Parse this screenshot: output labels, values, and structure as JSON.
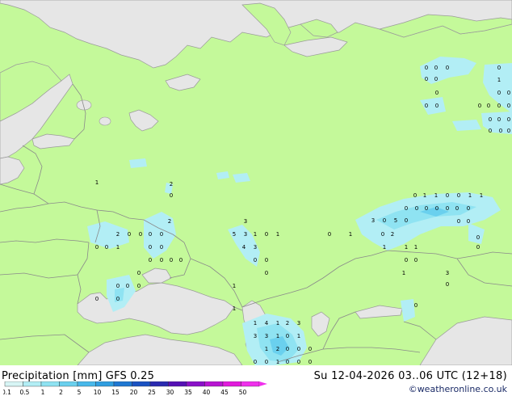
{
  "header": {
    "title": "Precipitation [mm]  GFS 0.25",
    "datetime": "Su 12-04-2026 03..06 UTC (12+18)"
  },
  "footer": {
    "credit": "©weatheronline.co.uk"
  },
  "legend": {
    "colors": [
      "#d7f5f5",
      "#b2eef5",
      "#8fe3f2",
      "#6ad0ee",
      "#48b8ea",
      "#2f9ee0",
      "#1e78d2",
      "#1a52c2",
      "#2a2ab0",
      "#5510b4",
      "#8a10c8",
      "#b814d2",
      "#e21adc",
      "#f030ec"
    ],
    "labels": [
      {
        "t": "0.1",
        "i": 0
      },
      {
        "t": "0.5",
        "i": 1
      },
      {
        "t": "1",
        "i": 2
      },
      {
        "t": "2",
        "i": 3
      },
      {
        "t": "5",
        "i": 4
      },
      {
        "t": "10",
        "i": 5
      },
      {
        "t": "15",
        "i": 6
      },
      {
        "t": "20",
        "i": 7
      },
      {
        "t": "25",
        "i": 8
      },
      {
        "t": "30",
        "i": 9
      },
      {
        "t": "35",
        "i": 10
      },
      {
        "t": "40",
        "i": 11
      },
      {
        "t": "45",
        "i": 12
      },
      {
        "t": "50",
        "i": 13
      }
    ]
  },
  "map": {
    "colors": {
      "land": "#c4f99a",
      "sea": "#e6e6e6",
      "border": "#8a8a8a",
      "coast": "#9a9a9a"
    },
    "precip_labels": [
      {
        "t": "0"
      },
      {
        "t": "0"
      },
      {
        "t": "0"
      },
      {
        "t": "0"
      },
      {
        "t": "0"
      },
      {
        "t": "0"
      },
      {
        "t": "0"
      },
      {
        "t": "0"
      },
      {
        "t": "0"
      },
      {
        "t": "1"
      },
      {
        "t": "0"
      },
      {
        "t": "0"
      },
      {
        "t": "0"
      },
      {
        "t": "0"
      },
      {
        "t": "0"
      },
      {
        "t": "0"
      },
      {
        "t": "0"
      },
      {
        "t": "0"
      },
      {
        "t": "0"
      },
      {
        "t": "0"
      },
      {
        "t": "0"
      },
      {
        "t": "0"
      },
      {
        "t": "0"
      },
      {
        "t": "1"
      },
      {
        "t": "1"
      },
      {
        "t": "0"
      },
      {
        "t": "0"
      },
      {
        "t": "1"
      },
      {
        "t": "1"
      },
      {
        "t": "0"
      },
      {
        "t": "0"
      },
      {
        "t": "0"
      },
      {
        "t": "0"
      },
      {
        "t": "0"
      },
      {
        "t": "0"
      },
      {
        "t": "0"
      },
      {
        "t": "3"
      },
      {
        "t": "0"
      },
      {
        "t": "5"
      },
      {
        "t": "0"
      },
      {
        "t": "0"
      },
      {
        "t": "2"
      },
      {
        "t": "0"
      },
      {
        "t": "0"
      },
      {
        "t": "0"
      },
      {
        "t": "0"
      },
      {
        "t": "1"
      },
      {
        "t": "1"
      },
      {
        "t": "1"
      },
      {
        "t": "0"
      },
      {
        "t": "0"
      },
      {
        "t": "1"
      },
      {
        "t": "3"
      },
      {
        "t": "0"
      },
      {
        "t": "0"
      },
      {
        "t": "1"
      },
      {
        "t": "1"
      },
      {
        "t": "1"
      },
      {
        "t": "4"
      },
      {
        "t": "1"
      },
      {
        "t": "2"
      },
      {
        "t": "3"
      },
      {
        "t": "3"
      },
      {
        "t": "3"
      },
      {
        "t": "1"
      },
      {
        "t": "0"
      },
      {
        "t": "1"
      },
      {
        "t": "1"
      },
      {
        "t": "2"
      },
      {
        "t": "0"
      },
      {
        "t": "0"
      },
      {
        "t": "0"
      },
      {
        "t": "0"
      },
      {
        "t": "2"
      },
      {
        "t": "0"
      },
      {
        "t": "1"
      },
      {
        "t": "3"
      },
      {
        "t": "5"
      },
      {
        "t": "3"
      },
      {
        "t": "1"
      },
      {
        "t": "0"
      },
      {
        "t": "1"
      },
      {
        "t": "4"
      },
      {
        "t": "3"
      },
      {
        "t": "0"
      },
      {
        "t": "0"
      },
      {
        "t": "0"
      },
      {
        "t": "0"
      },
      {
        "t": "1"
      },
      {
        "t": "2"
      },
      {
        "t": "0"
      },
      {
        "t": "0"
      },
      {
        "t": "0"
      },
      {
        "t": "0"
      },
      {
        "t": "2"
      },
      {
        "t": "0"
      },
      {
        "t": "0"
      },
      {
        "t": "0"
      },
      {
        "t": "0"
      },
      {
        "t": "0"
      },
      {
        "t": "0"
      },
      {
        "t": "0"
      },
      {
        "t": "0"
      },
      {
        "t": "1"
      },
      {
        "t": "0"
      },
      {
        "t": "0"
      },
      {
        "t": "0"
      },
      {
        "t": "0"
      },
      {
        "t": "0"
      },
      {
        "t": "0"
      },
      {
        "t": "0"
      },
      {
        "t": "0"
      },
      {
        "t": "1"
      },
      {
        "t": "0"
      },
      {
        "t": "0"
      },
      {
        "t": "0"
      }
    ]
  }
}
